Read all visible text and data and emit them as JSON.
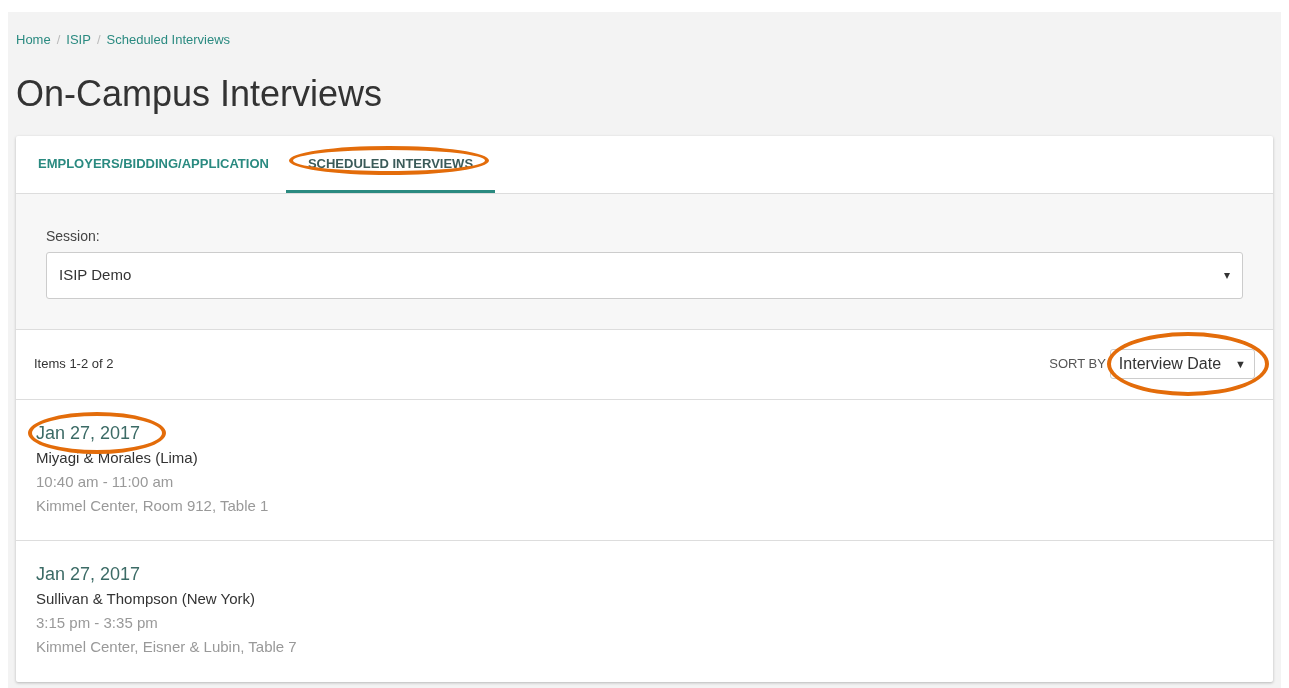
{
  "breadcrumb": [
    {
      "label": "Home"
    },
    {
      "label": "ISIP"
    },
    {
      "label": "Scheduled Interviews"
    }
  ],
  "breadcrumb_separator": "/",
  "title": "On-Campus Interviews",
  "tabs": [
    {
      "label": "EMPLOYERS/BIDDING/APPLICATION",
      "selected": false,
      "circled": false
    },
    {
      "label": "SCHEDULED INTERVIEWS",
      "selected": true,
      "circled": true
    }
  ],
  "session": {
    "label": "Session:",
    "value": "ISIP Demo",
    "caret": "▾"
  },
  "list_header": {
    "count": "Items 1-2 of 2",
    "sort_label": "SORT BY",
    "sort_value": "Interview Date",
    "sort_caret": "▼",
    "sort_circled": true
  },
  "interviews": [
    {
      "date": "Jan 27, 2017",
      "date_circled": true,
      "employer": "Miyagi & Morales (Lima)",
      "time": "10:40 am - 11:00 am",
      "location": "Kimmel Center, Room 912, Table 1"
    },
    {
      "date": "Jan 27, 2017",
      "date_circled": false,
      "employer": "Sullivan & Thompson (New York)",
      "time": "3:15 pm - 3:35 pm",
      "location": "Kimmel Center, Eisner & Lubin, Table 7"
    }
  ]
}
